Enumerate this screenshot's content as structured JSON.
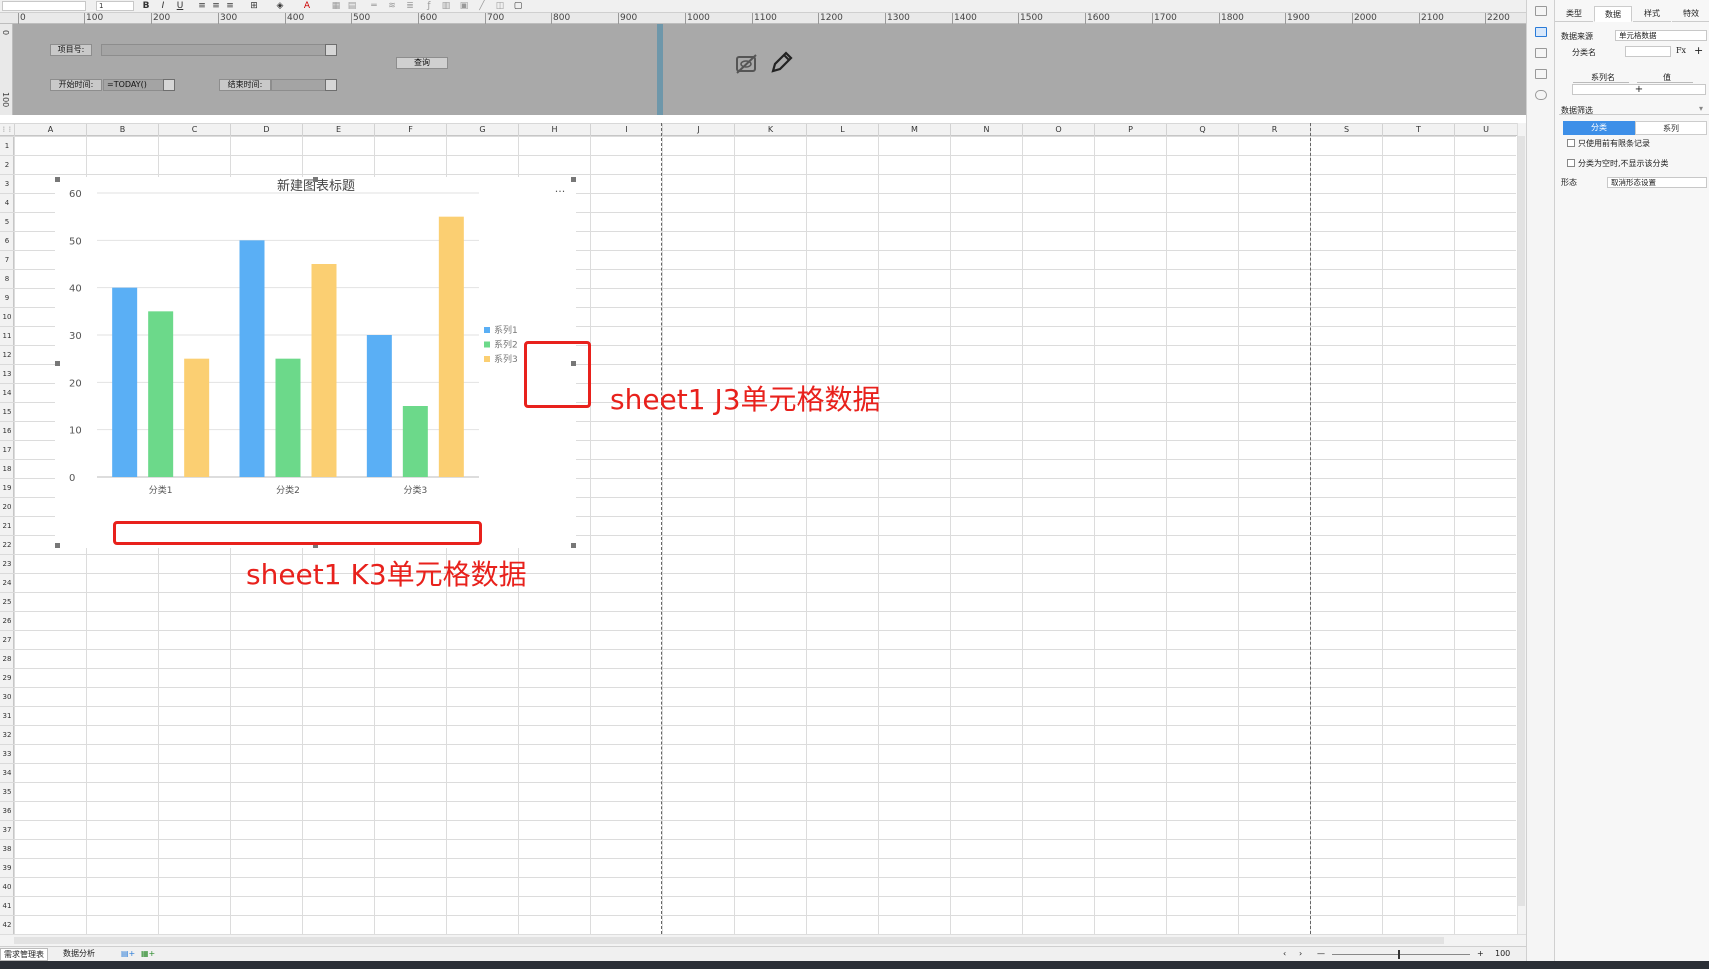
{
  "toolbar": {
    "font_size_value": "1",
    "bold_label": "B",
    "italic_label": "I",
    "underline_label": "U"
  },
  "ruler": {
    "ticks": [
      "0",
      "100",
      "200",
      "300",
      "400",
      "500",
      "600",
      "700",
      "800",
      "900",
      "1000",
      "1100",
      "1200",
      "1300",
      "1400",
      "1500",
      "1600",
      "1700",
      "1800",
      "1900",
      "2000",
      "2100",
      "2200"
    ],
    "vertical_label": "100"
  },
  "param_panel": {
    "project_label": "项目号:",
    "project_value": "",
    "query_button": "查询",
    "start_label": "开始时间:",
    "start_value": "=TODAY()",
    "end_label": "结束时间:",
    "end_value": ""
  },
  "columns": [
    "A",
    "B",
    "C",
    "D",
    "E",
    "F",
    "G",
    "H",
    "I",
    "J",
    "K",
    "L",
    "M",
    "N",
    "O",
    "P",
    "Q",
    "R",
    "S",
    "T",
    "U"
  ],
  "rows": [
    "1",
    "2",
    "3",
    "4",
    "5",
    "6",
    "7",
    "8",
    "9",
    "10",
    "11",
    "12",
    "13",
    "14",
    "15",
    "16",
    "17",
    "18",
    "19",
    "20",
    "21",
    "22",
    "23",
    "24",
    "25",
    "26",
    "27",
    "28",
    "29",
    "30",
    "31",
    "32",
    "33",
    "34",
    "35",
    "36",
    "37",
    "38",
    "39",
    "40",
    "41",
    "42"
  ],
  "chart_data": {
    "type": "bar",
    "title": "新建图表标题",
    "categories": [
      "分类1",
      "分类2",
      "分类3"
    ],
    "series": [
      {
        "name": "系列1",
        "values": [
          40,
          50,
          30
        ],
        "color": "#5aaff5"
      },
      {
        "name": "系列2",
        "values": [
          35,
          25,
          15
        ],
        "color": "#6cd98a"
      },
      {
        "name": "系列3",
        "values": [
          25,
          45,
          55
        ],
        "color": "#fbcf72"
      }
    ],
    "y_ticks": [
      "0",
      "10",
      "20",
      "30",
      "40",
      "50",
      "60"
    ],
    "ylim": [
      0,
      60
    ],
    "grid": true,
    "legend_position": "right"
  },
  "chart_menu": "···",
  "annotations": {
    "legend_note": "sheet1 J3单元格数据",
    "axis_note": "sheet1 K3单元格数据",
    "highlight_color": "#e8211c"
  },
  "sheet_tabs": [
    "需求管理表",
    "数据分析"
  ],
  "status": {
    "zoom_minus": "—",
    "zoom_plus": "+",
    "zoom_value": "100"
  },
  "right_panel": {
    "tabs": [
      "类型",
      "数据",
      "样式",
      "特效"
    ],
    "active_tab": "数据",
    "data_source_label": "数据来源",
    "data_source_value": "单元格数据",
    "category_name_label": "分类名",
    "fx_label": "Fx",
    "series_name_header": "系列名",
    "value_header": "值",
    "add_symbol": "+",
    "filter_section": "数据筛选",
    "segment_category": "分类",
    "segment_series": "系列",
    "option_limit": "只使用前有限条记录",
    "option_hide_empty": "分类为空时,不显示该分类",
    "shape_label": "形态",
    "shape_value": "取消形态设置"
  }
}
